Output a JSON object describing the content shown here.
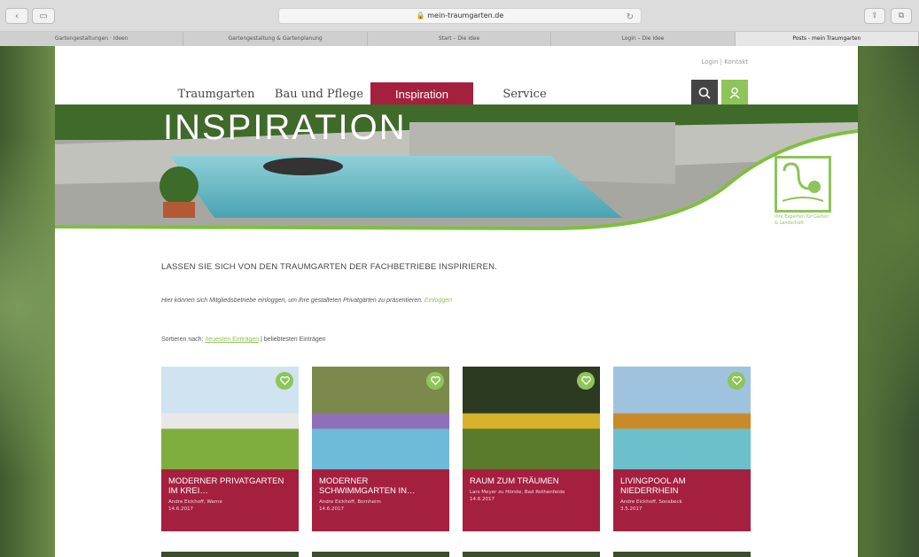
{
  "browser": {
    "url": "mein-traumgarten.de",
    "tabs": [
      {
        "label": "Gartengestaltungen · Ideen",
        "active": false
      },
      {
        "label": "Gartengestaltung & Gartenplanung",
        "active": false
      },
      {
        "label": "Start – Die Idee",
        "active": false
      },
      {
        "label": "Login – Die Idee",
        "active": false
      },
      {
        "label": "Posts - mein Traumgarten",
        "active": true
      }
    ]
  },
  "header": {
    "login_links": "Login | Kontakt",
    "nav": [
      {
        "label": "Traumgarten",
        "active": false
      },
      {
        "label": "Bau und Pflege",
        "active": false
      },
      {
        "label": "Inspiration",
        "active": true
      },
      {
        "label": "Service",
        "active": false
      }
    ]
  },
  "hero": {
    "title": "INSPIRATION"
  },
  "logo": {
    "text": "Ihre Experten für Garten & Landschaft"
  },
  "intro": {
    "headline": "LASSEN SIE SICH VON DEN TRAUMGARTEN DER FACHBETRIEBE INSPIRIEREN.",
    "note": "Hier können sich Mitgliedsbetriebe einloggen, um Ihre gestalteten Privatgärten zu präsentieren.",
    "note_link": "Einloggen",
    "sort_prefix": "Sortieren nach:",
    "sort_link": "neuesten Einträgen",
    "sort_suffix": "| beliebtesten Einträgen"
  },
  "cards": [
    {
      "title": "MODERNER PRIVATGARTEN IM KREI…",
      "author": "Andre Eickhoff, Werne",
      "date": "14.6.2017",
      "palette": [
        "#cfe3f0",
        "#e8e8e8",
        "#7fae3e"
      ]
    },
    {
      "title": "MODERNER SCHWIMMGARTEN IN…",
      "author": "Andre Eickhoff, Bornheim",
      "date": "14.6.2017",
      "palette": [
        "#7b8a4c",
        "#8f6fb8",
        "#6dbbd8"
      ]
    },
    {
      "title": "RAUM ZUM TRÄUMEN",
      "author": "Lars Meyer zu Hörste, Bad Rothenfelde",
      "date": "14.6.2017",
      "palette": [
        "#2c3a22",
        "#d7b22a",
        "#5a7a2c"
      ]
    },
    {
      "title": "LIVINGPOOL AM NIEDERRHEIN",
      "author": "Andre Eickhoff, Sonsbeck",
      "date": "3.5.2017",
      "palette": [
        "#9fc3df",
        "#c98a2a",
        "#6cc0cc"
      ]
    }
  ],
  "colors": {
    "brand_red": "#a5203f",
    "brand_green": "#8ec45a",
    "dark": "#444444"
  }
}
